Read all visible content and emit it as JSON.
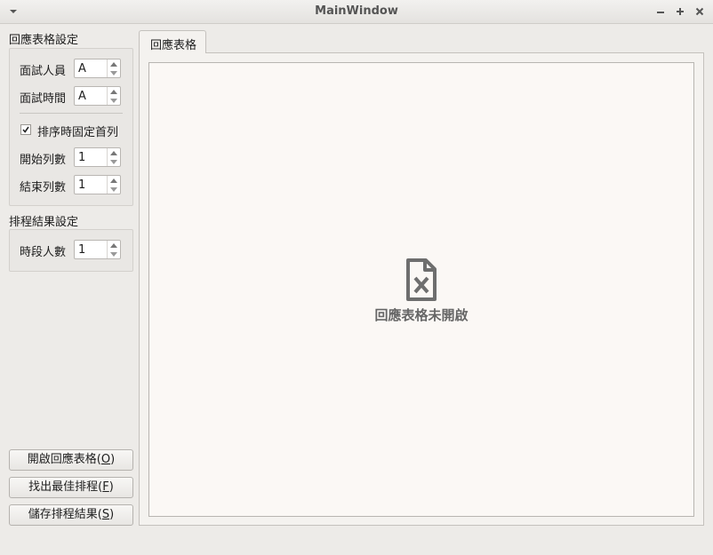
{
  "window": {
    "title": "MainWindow"
  },
  "response_sheet_settings": {
    "title": "回應表格設定",
    "interviewer": {
      "label": "面試人員",
      "value": "A"
    },
    "interview_time": {
      "label": "面試時間",
      "value": "A"
    },
    "fix_first_row": {
      "label": "排序時固定首列",
      "checked": true
    },
    "start_row": {
      "label": "開始列數",
      "value": "1"
    },
    "end_row": {
      "label": "結束列數",
      "value": "1"
    }
  },
  "schedule_result_settings": {
    "title": "排程結果設定",
    "people_per_slot": {
      "label": "時段人數",
      "value": "1"
    }
  },
  "buttons": {
    "open": {
      "text": "開啟回應表格(",
      "mnemonic": "O",
      "close": ")"
    },
    "find": {
      "text": "找出最佳排程(",
      "mnemonic": "F",
      "close": ")"
    },
    "save": {
      "text": "儲存排程結果(",
      "mnemonic": "S",
      "close": ")"
    }
  },
  "tabs": [
    {
      "label": "回應表格"
    }
  ],
  "empty_state": {
    "message": "回應表格未開啟",
    "icon": "file-x-icon"
  }
}
